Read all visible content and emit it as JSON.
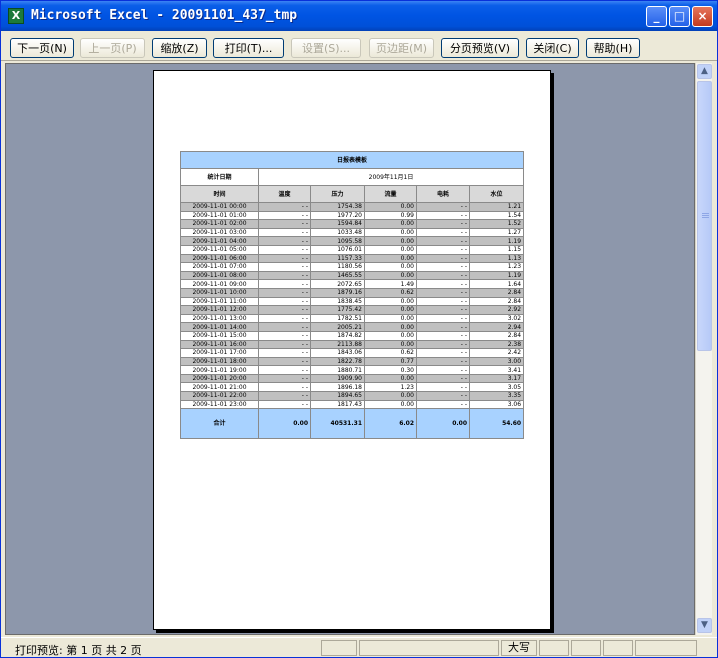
{
  "window": {
    "title": "Microsoft Excel - 20091101_437_tmp",
    "app_icon": "excel-icon",
    "controls": [
      "minimize-icon",
      "maximize-icon",
      "close-icon"
    ]
  },
  "toolbar": {
    "next": "下一页(N)",
    "prev": "上一页(P)",
    "zoom": "缩放(Z)",
    "print": "打印(T)...",
    "setup": "设置(S)...",
    "margins": "页边距(M)",
    "page_break": "分页预览(V)",
    "close": "关闭(C)",
    "help": "帮助(H)"
  },
  "report": {
    "title": "日报表模板",
    "date_label": "统计日期",
    "date_value": "2009年11月1日",
    "columns": [
      "时间",
      "温度",
      "压力",
      "流量",
      "电耗",
      "水位"
    ],
    "rows": [
      [
        "2009-11-01 00:00",
        "- -",
        "1754.38",
        "0.00",
        "- -",
        "1.21"
      ],
      [
        "2009-11-01 01:00",
        "- -",
        "1977.20",
        "0.99",
        "- -",
        "1.54"
      ],
      [
        "2009-11-01 02:00",
        "- -",
        "1594.84",
        "0.00",
        "- -",
        "1.52"
      ],
      [
        "2009-11-01 03:00",
        "- -",
        "1033.48",
        "0.00",
        "- -",
        "1.27"
      ],
      [
        "2009-11-01 04:00",
        "- -",
        "1095.58",
        "0.00",
        "- -",
        "1.19"
      ],
      [
        "2009-11-01 05:00",
        "- -",
        "1076.01",
        "0.00",
        "- -",
        "1.15"
      ],
      [
        "2009-11-01 06:00",
        "- -",
        "1157.33",
        "0.00",
        "- -",
        "1.13"
      ],
      [
        "2009-11-01 07:00",
        "- -",
        "1180.56",
        "0.00",
        "- -",
        "1.23"
      ],
      [
        "2009-11-01 08:00",
        "- -",
        "1465.55",
        "0.00",
        "- -",
        "1.19"
      ],
      [
        "2009-11-01 09:00",
        "- -",
        "2072.65",
        "1.49",
        "- -",
        "1.64"
      ],
      [
        "2009-11-01 10:00",
        "- -",
        "1879.16",
        "0.62",
        "- -",
        "2.84"
      ],
      [
        "2009-11-01 11:00",
        "- -",
        "1838.45",
        "0.00",
        "- -",
        "2.84"
      ],
      [
        "2009-11-01 12:00",
        "- -",
        "1775.42",
        "0.00",
        "- -",
        "2.92"
      ],
      [
        "2009-11-01 13:00",
        "- -",
        "1782.51",
        "0.00",
        "- -",
        "3.02"
      ],
      [
        "2009-11-01 14:00",
        "- -",
        "2005.21",
        "0.00",
        "- -",
        "2.94"
      ],
      [
        "2009-11-01 15:00",
        "- -",
        "1874.82",
        "0.00",
        "- -",
        "2.84"
      ],
      [
        "2009-11-01 16:00",
        "- -",
        "2113.88",
        "0.00",
        "- -",
        "2.38"
      ],
      [
        "2009-11-01 17:00",
        "- -",
        "1843.06",
        "0.62",
        "- -",
        "2.42"
      ],
      [
        "2009-11-01 18:00",
        "- -",
        "1822.78",
        "0.77",
        "- -",
        "3.00"
      ],
      [
        "2009-11-01 19:00",
        "- -",
        "1880.71",
        "0.30",
        "- -",
        "3.41"
      ],
      [
        "2009-11-01 20:00",
        "- -",
        "1909.90",
        "0.00",
        "- -",
        "3.17"
      ],
      [
        "2009-11-01 21:00",
        "- -",
        "1896.18",
        "1.23",
        "- -",
        "3.05"
      ],
      [
        "2009-11-01 22:00",
        "- -",
        "1894.65",
        "0.00",
        "- -",
        "3.35"
      ],
      [
        "2009-11-01 23:00",
        "- -",
        "1817.43",
        "0.00",
        "- -",
        "3.06"
      ]
    ],
    "total": [
      "合计",
      "0.00",
      "40531.31",
      "6.02",
      "0.00",
      "54.60"
    ]
  },
  "statusbar": {
    "text": "打印预览: 第 1 页  共 2 页",
    "caps": "大写"
  },
  "colors": {
    "title_bar": "#0054e3",
    "preview_bg": "#8d97ab",
    "report_header": "#a8d2ff",
    "row_shade": "#c0c0c0"
  }
}
